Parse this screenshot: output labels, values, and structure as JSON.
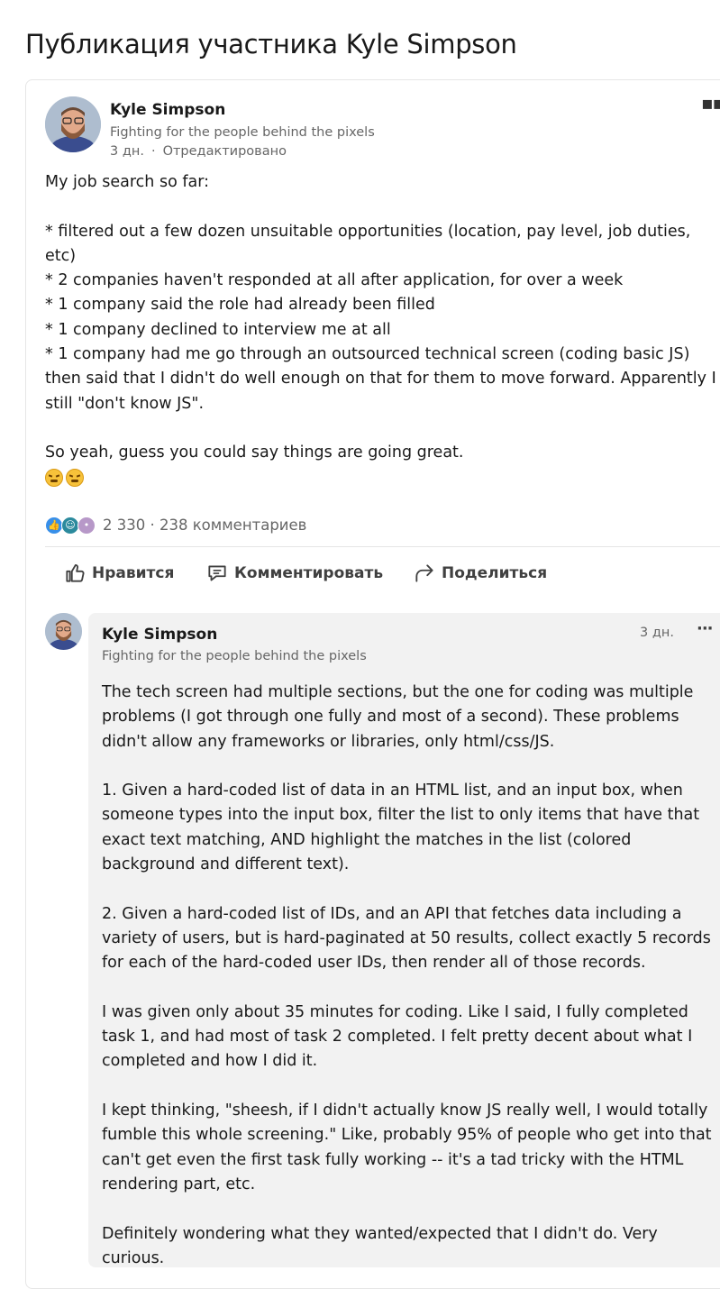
{
  "page": {
    "title": "Публикация участника Kyle Simpson"
  },
  "post": {
    "author": {
      "name": "Kyle Simpson",
      "headline": "Fighting for the people behind the pixels",
      "time": "3 дн.",
      "separator": "·",
      "edited": "Отредактировано"
    },
    "more_icon": "more-horizontal-icon",
    "body": "My job search so far:\n\n* filtered out a few dozen unsuitable opportunities (location, pay level, job duties, etc)\n* 2 companies haven't responded at all after application, for over a week\n* 1 company said the role had already been filled\n* 1 company declined to interview me at all\n* 1 company had me go through an outsourced technical screen (coding basic JS) then said that I didn't do well enough on that for them to move forward. Apparently I still \"don't know JS\".\n\nSo yeah, guess you could say things are going great.",
    "emojis": [
      "confounded-face",
      "weary-face"
    ],
    "reactions": {
      "icons": [
        "like-reaction-icon",
        "funny-reaction-icon",
        "curious-reaction-icon"
      ],
      "summary": "2 330 · 238 комментариев"
    },
    "actions": {
      "like": "Нравится",
      "comment": "Комментировать",
      "share": "Поделиться"
    }
  },
  "comment": {
    "author": {
      "name": "Kyle Simpson",
      "headline": "Fighting for the people behind the pixels"
    },
    "time": "3 дн.",
    "more_icon": "more-horizontal-icon",
    "body": "The tech screen had multiple sections, but the one for coding was multiple problems (I got through one fully and most of a second). These problems didn't allow any frameworks or libraries, only html/css/JS.\n\n1. Given a hard-coded list of data in an HTML list, and an input box, when someone types into the input box, filter the list to only items that have that exact text matching, AND highlight the matches in the list (colored background and different text).\n\n2. Given a hard-coded list of IDs, and an API that fetches data including a variety of users, but is hard-paginated at 50 results, collect exactly 5 records for each of the hard-coded user IDs, then render all of those records.\n\nI was given only about 35 minutes for coding. Like I said, I fully completed task 1, and had most of task 2 completed. I felt pretty decent about what I completed and how I did it.\n\nI kept thinking, \"sheesh, if I didn't actually know JS really well, I would totally fumble this whole screening.\" Like, probably 95% of people who get into that can't get even the first task fully working -- it's a tad tricky with the HTML rendering part, etc.\n\nDefinitely wondering what they wanted/expected that I didn't do. Very curious."
  },
  "colors": {
    "text": "#191919",
    "muted": "#666666",
    "comment_bg": "#f2f2f2",
    "like_blue": "#378fe9"
  }
}
